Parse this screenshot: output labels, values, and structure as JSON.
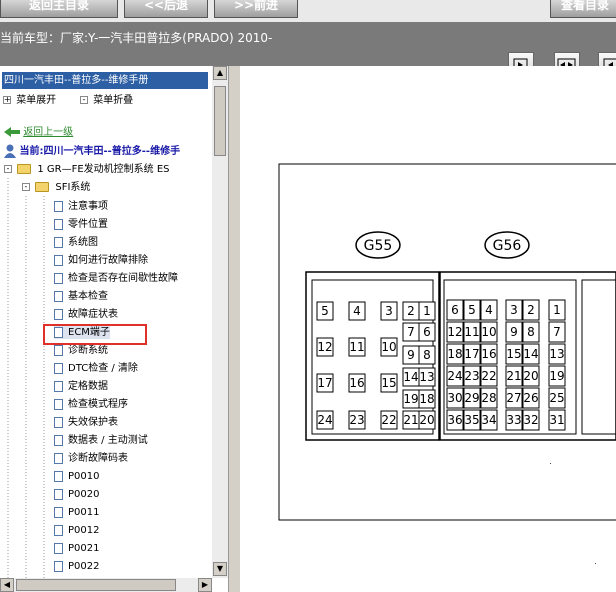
{
  "toolbar": {
    "home_label": "返回主目录",
    "prev_label": "<<后退",
    "next_label": ">>前进",
    "view_label": "查看目录"
  },
  "info": {
    "car_model": "当前车型：厂家:Y-一汽丰田普拉多(PRADO) 2010-"
  },
  "tree": {
    "header": "四川一汽丰田--普拉多--维修手册",
    "expand_label": "菜单展开",
    "collapse_label": "菜单折叠",
    "back_label": "返回上一级",
    "current_label": "当前:四川一汽丰田--普拉多--维修手",
    "folder1": "1 GR—FE发动机控制系统 ES",
    "folder2": "SFI系统",
    "items": [
      "注意事项",
      "零件位置",
      "系统图",
      "如何进行故障排除",
      "检查是否存在间歇性故障",
      "基本检查",
      "故障症状表",
      "ECM端子",
      "诊断系统",
      "DTC检查 / 清除",
      "定格数据",
      "检查模式程序",
      "失效保护表",
      "数据表 / 主动测试",
      "诊断故障码表",
      "P0010",
      "P0020",
      "P0011",
      "P0012",
      "P0021",
      "P0022"
    ]
  },
  "diagram": {
    "connector_a": "G55",
    "connector_b": "G56",
    "g55_pins": [
      "5",
      "4",
      "3",
      "2",
      "1",
      "7",
      "6",
      "12",
      "11",
      "10",
      "9",
      "8",
      "14",
      "13",
      "17",
      "16",
      "15",
      "19",
      "18",
      "24",
      "23",
      "22",
      "21",
      "20"
    ],
    "g56_left_pins": [
      "6",
      "5",
      "4",
      "12",
      "11",
      "10",
      "18",
      "17",
      "16",
      "24",
      "23",
      "22",
      "30",
      "29",
      "28",
      "36",
      "35",
      "34"
    ],
    "g56_right_pins": [
      "3",
      "2",
      "1",
      "9",
      "8",
      "7",
      "15",
      "14",
      "13",
      "21",
      "20",
      "19",
      "27",
      "26",
      "25",
      "33",
      "32",
      "31"
    ]
  },
  "colors": {
    "highlight_box": "#e0302a",
    "tree_header": "#2c5fa4",
    "link_green": "#2e8b2e",
    "current_blue": "#1a1aa8"
  }
}
